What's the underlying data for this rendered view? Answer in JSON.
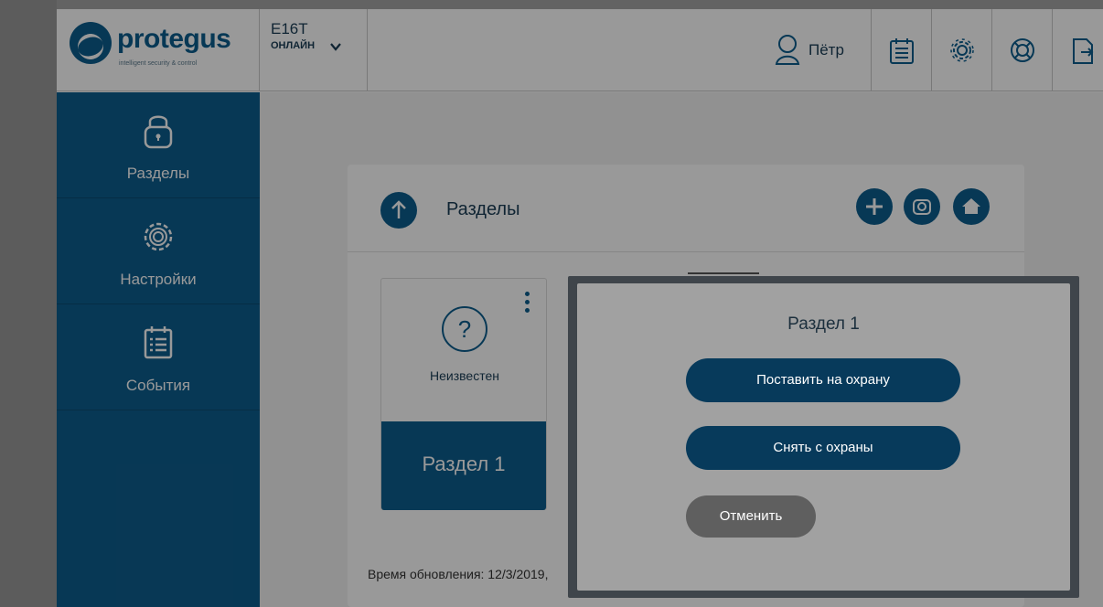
{
  "header": {
    "logo_text": "protegus",
    "logo_tagline": "intelligent security & control",
    "device_name": "E16T",
    "device_status": "ОНЛАЙН",
    "user_name": "Пётр",
    "icons": [
      "user-icon",
      "events-icon",
      "settings-icon",
      "help-icon",
      "logout-icon"
    ]
  },
  "sidebar": {
    "items": [
      {
        "label": "Разделы",
        "icon": "lock-icon"
      },
      {
        "label": "Настройки",
        "icon": "gear-icon"
      },
      {
        "label": "События",
        "icon": "calendar-icon"
      }
    ]
  },
  "main": {
    "title": "Разделы",
    "actions": [
      "add-icon",
      "camera-icon",
      "home-icon"
    ],
    "tile": {
      "state": "Неизвестен",
      "name": "Раздел 1"
    },
    "update_text": "Время обновления: 12/3/2019,"
  },
  "dialog": {
    "title": "Раздел 1",
    "arm_label": "Поставить на охрану",
    "disarm_label": "Снять с охраны",
    "cancel_label": "Отменить"
  },
  "colors": {
    "brand": "#0d5e8e",
    "dialog_button": "#073a5b",
    "cancel_button": "#5f5f5f"
  }
}
